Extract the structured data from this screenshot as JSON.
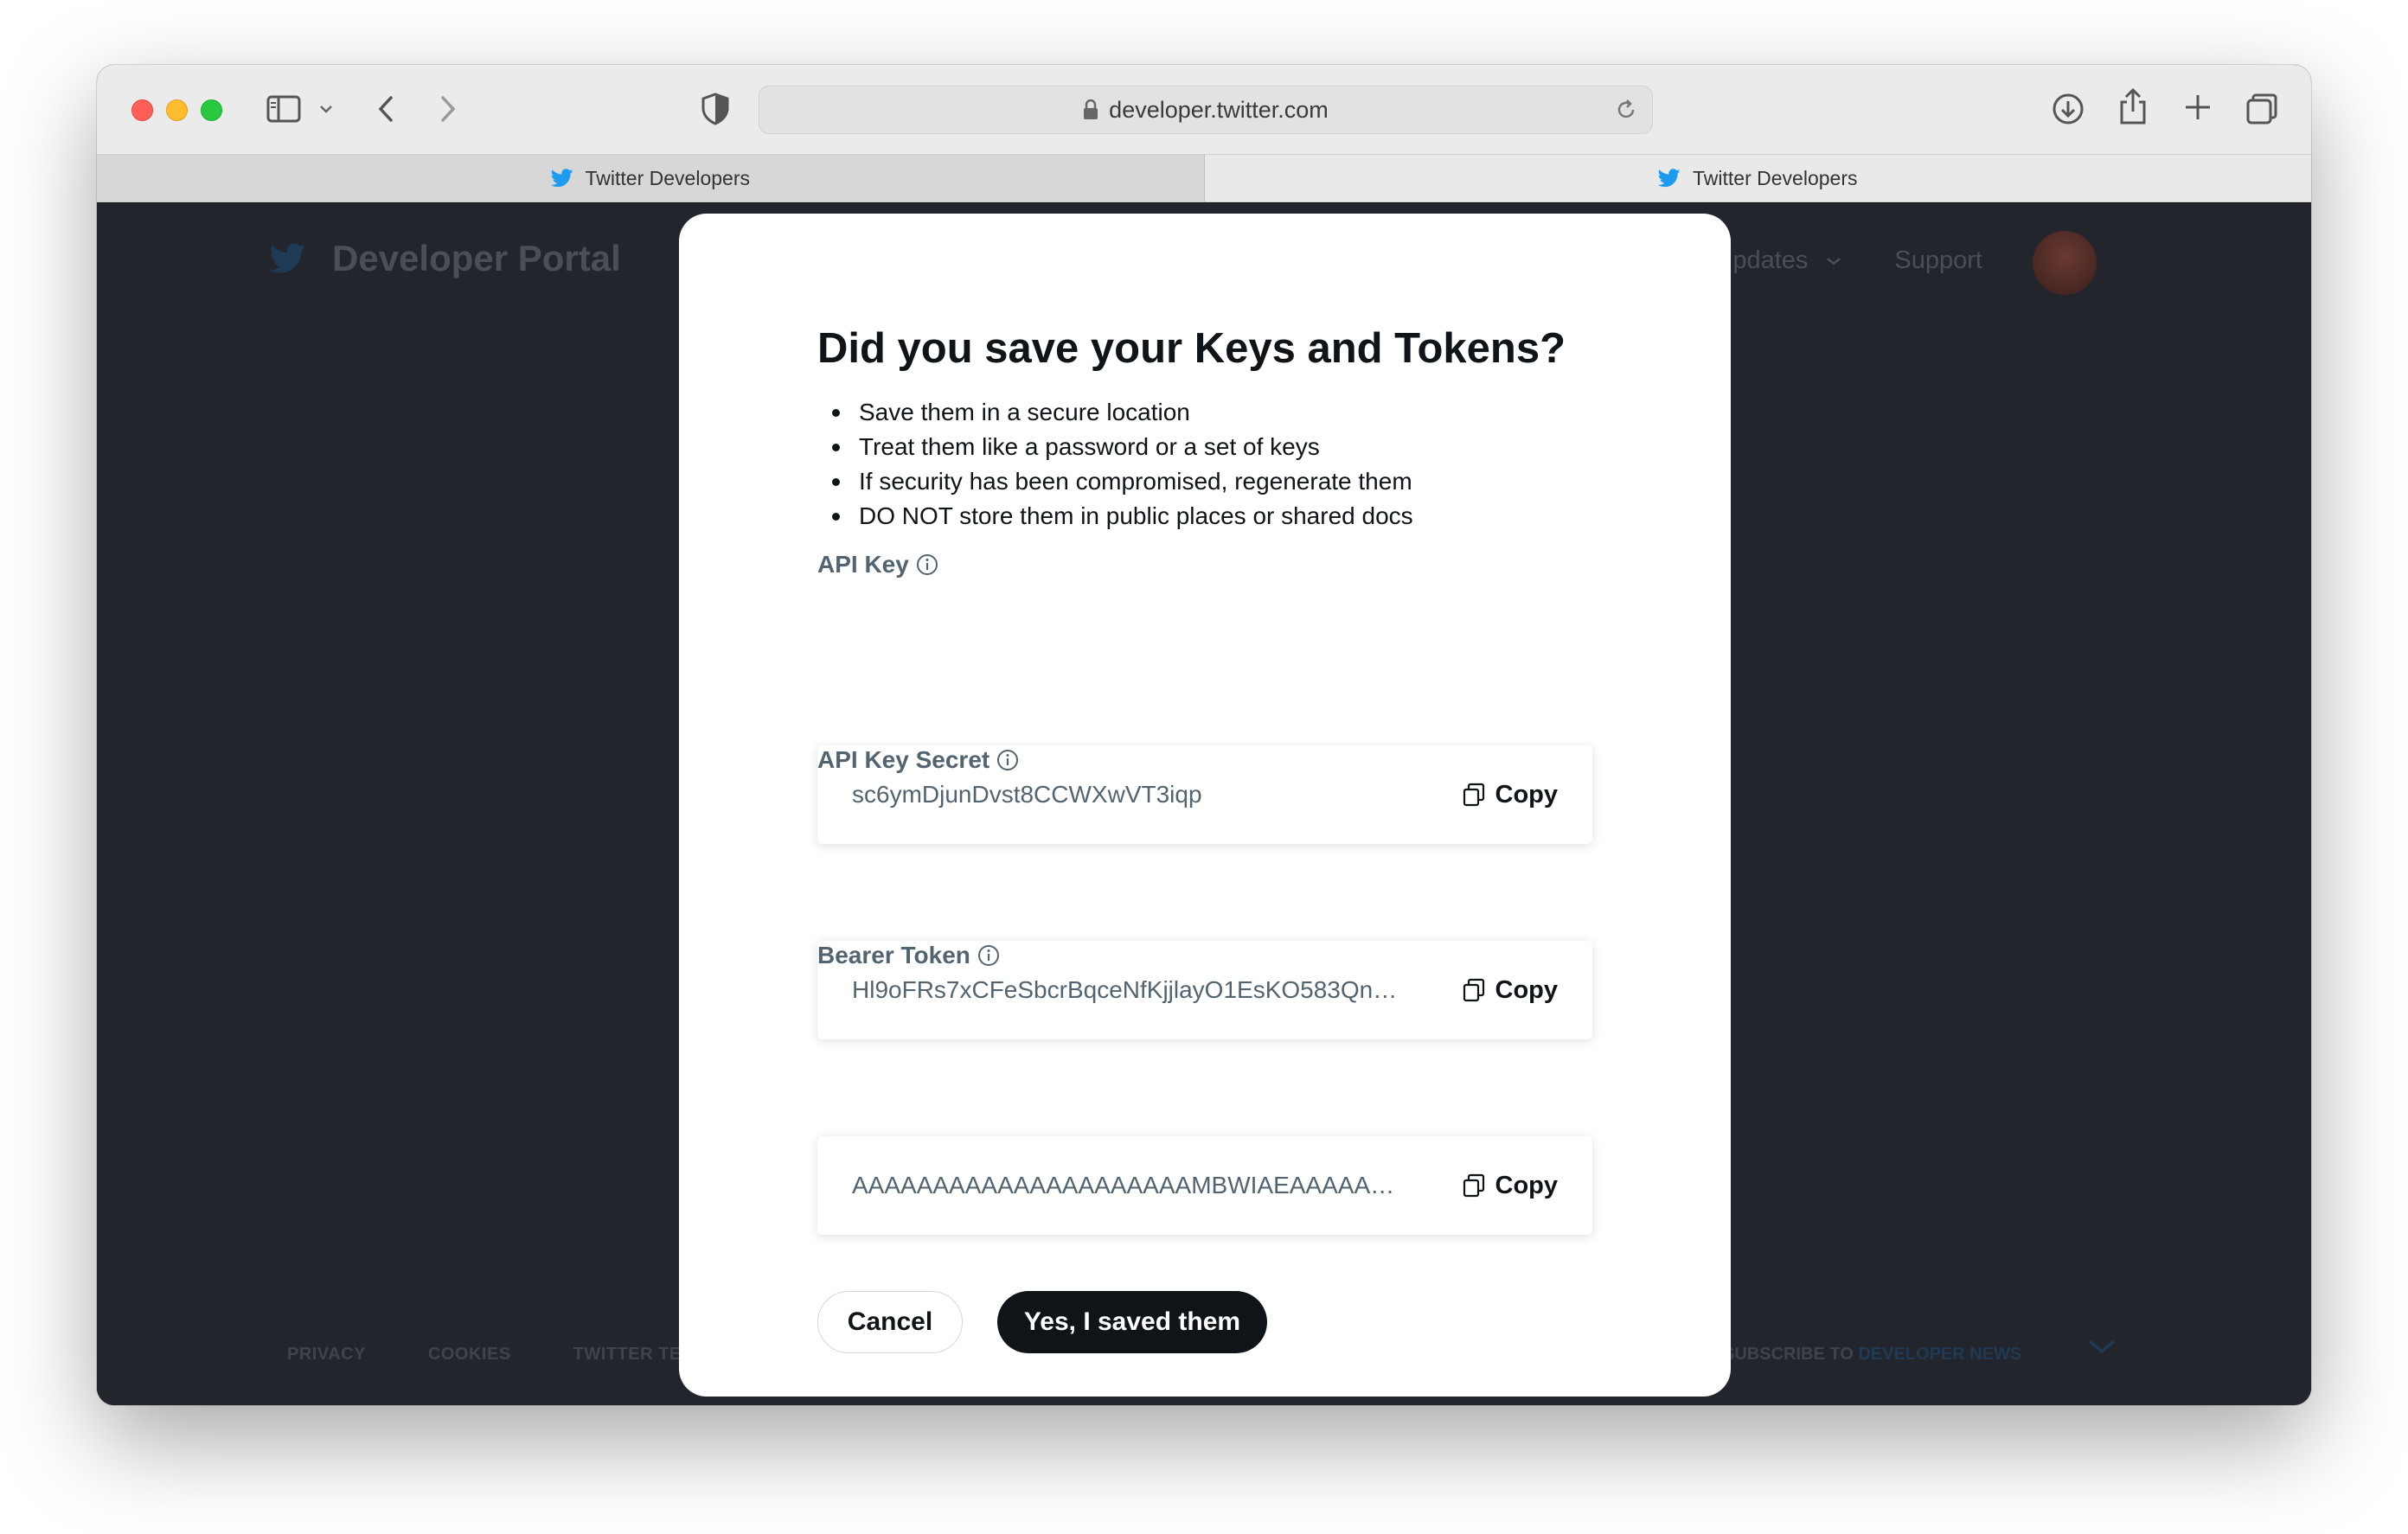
{
  "browser": {
    "url": "developer.twitter.com",
    "tabs": [
      {
        "label": "Twitter Developers"
      },
      {
        "label": "Twitter Developers"
      }
    ]
  },
  "portal": {
    "title": "Developer Portal",
    "nav": {
      "updates": "Updates",
      "support": "Support"
    },
    "footer": {
      "links": [
        "PRIVACY",
        "COOKIES",
        "TWITTER TERMS & CONDITIONS"
      ],
      "subscribe_prefix": "SUBSCRIBE TO ",
      "subscribe_link": "DEVELOPER NEWS"
    }
  },
  "modal": {
    "title": "Did you save your Keys and Tokens?",
    "bullets": [
      "Save them in a secure location",
      "Treat them like a password or a set of keys",
      "If security has been compromised, regenerate them",
      "DO NOT store them in public places or shared docs"
    ],
    "fields": [
      {
        "label": "API Key",
        "value": "sc6ymDjunDvst8CCWXwVT3iqp",
        "copy": "Copy"
      },
      {
        "label": "API Key Secret",
        "value": "Hl9oFRs7xCFeSbcrBqceNfKjjlayO1EsKO583QnE...",
        "copy": "Copy"
      },
      {
        "label": "Bearer Token",
        "value": "AAAAAAAAAAAAAAAAAAAAAMBWIAEAAAAAS...",
        "copy": "Copy"
      }
    ],
    "cancel_label": "Cancel",
    "confirm_label": "Yes, I saved them"
  },
  "colors": {
    "accent": "#1d9bf0",
    "overlay": "#14171c",
    "primary_button": "#0f1419",
    "secondary_text": "#536471"
  }
}
